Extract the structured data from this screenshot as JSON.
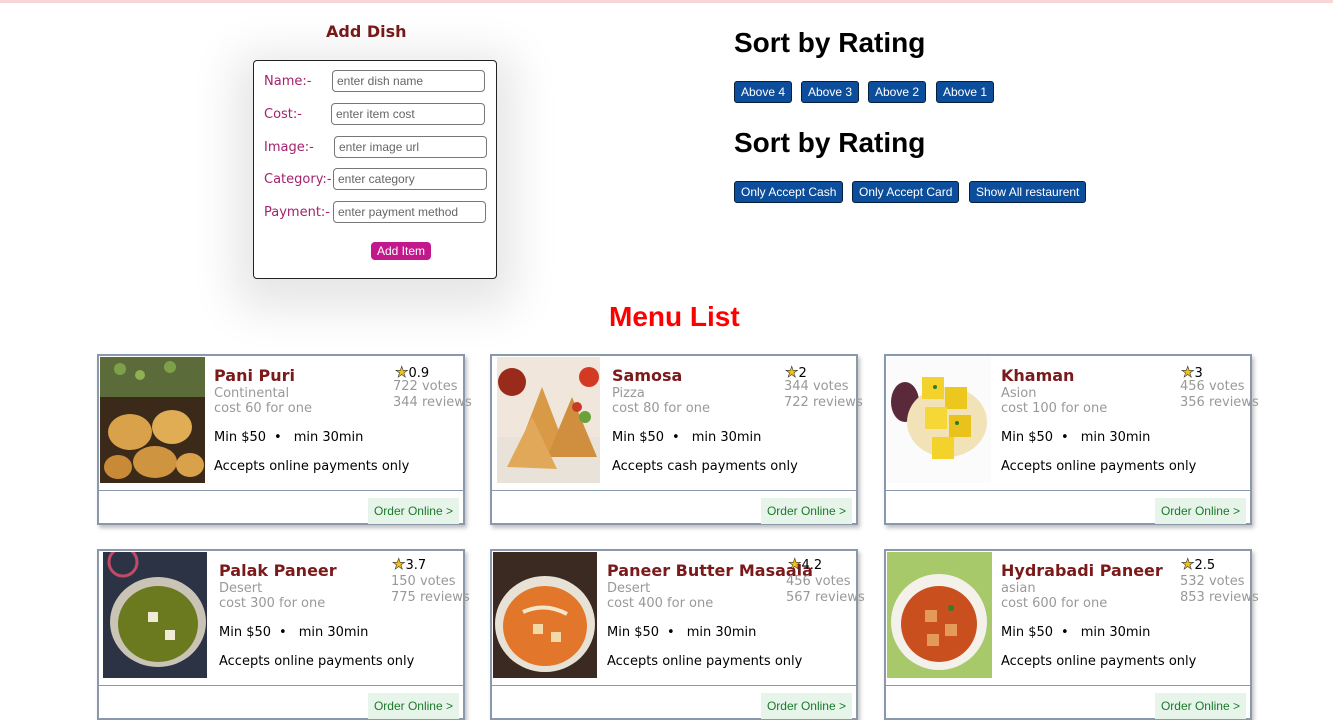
{
  "add_dish": {
    "title": "Add Dish",
    "fields": [
      {
        "label": "Name:-",
        "placeholder": "enter dish name"
      },
      {
        "label": "Cost:-",
        "placeholder": "enter item cost"
      },
      {
        "label": "Image:-",
        "placeholder": "enter image url"
      },
      {
        "label": "Category:-",
        "placeholder": "enter category"
      },
      {
        "label": "Payment:-",
        "placeholder": "enter payment method"
      }
    ],
    "submit_label": "Add Item"
  },
  "sort_rating": {
    "title": "Sort by Rating",
    "buttons": [
      "Above 4",
      "Above 3",
      "Above 2",
      "Above 1"
    ]
  },
  "sort_payment": {
    "title": "Sort by Rating",
    "buttons": [
      "Only Accept Cash",
      "Only Accept Card",
      "Show All restaurent"
    ]
  },
  "menu": {
    "title": "Menu List",
    "order_label": "Order Online >",
    "items": [
      {
        "name": "Pani Puri",
        "category": "Continental",
        "cost": "cost 60 for one",
        "rating": "0.9",
        "votes": "722 votes",
        "reviews": "344 reviews",
        "min_price": "Min $50",
        "min_time": "min 30min",
        "payment": "Accepts online payments only"
      },
      {
        "name": "Samosa",
        "category": "Pizza",
        "cost": "cost 80 for one",
        "rating": "2",
        "votes": "344 votes",
        "reviews": "722 reviews",
        "min_price": "Min $50",
        "min_time": "min 30min",
        "payment": "Accepts cash payments only"
      },
      {
        "name": "Khaman",
        "category": "Asion",
        "cost": "cost 100 for one",
        "rating": "3",
        "votes": "456 votes",
        "reviews": "356 reviews",
        "min_price": "Min $50",
        "min_time": "min 30min",
        "payment": "Accepts online payments only"
      },
      {
        "name": "Palak Paneer",
        "category": "Desert",
        "cost": "cost 300 for one",
        "rating": "3.7",
        "votes": "150 votes",
        "reviews": "775 reviews",
        "min_price": "Min $50",
        "min_time": "min 30min",
        "payment": "Accepts online payments only"
      },
      {
        "name": "Paneer Butter Masaala",
        "category": "Desert",
        "cost": "cost 400 for one",
        "rating": "4.2",
        "votes": "456 votes",
        "reviews": "567 reviews",
        "min_price": "Min $50",
        "min_time": "min 30min",
        "payment": "Accepts online payments only"
      },
      {
        "name": "Hydrabadi Paneer",
        "category": "asian",
        "cost": "cost 600 for one",
        "rating": "2.5",
        "votes": "532 votes",
        "reviews": "853 reviews",
        "min_price": "Min $50",
        "min_time": "min 30min",
        "payment": "Accepts online payments only"
      }
    ]
  },
  "icons": {
    "rating": "star-icon"
  },
  "colors": {
    "accent": "#c2188b",
    "button": "#0d4e9c",
    "menu_title": "#ff0000",
    "dish_name": "#7a1a1a",
    "order_bg": "#e6f4ea",
    "order_text": "#1b7a2a"
  }
}
